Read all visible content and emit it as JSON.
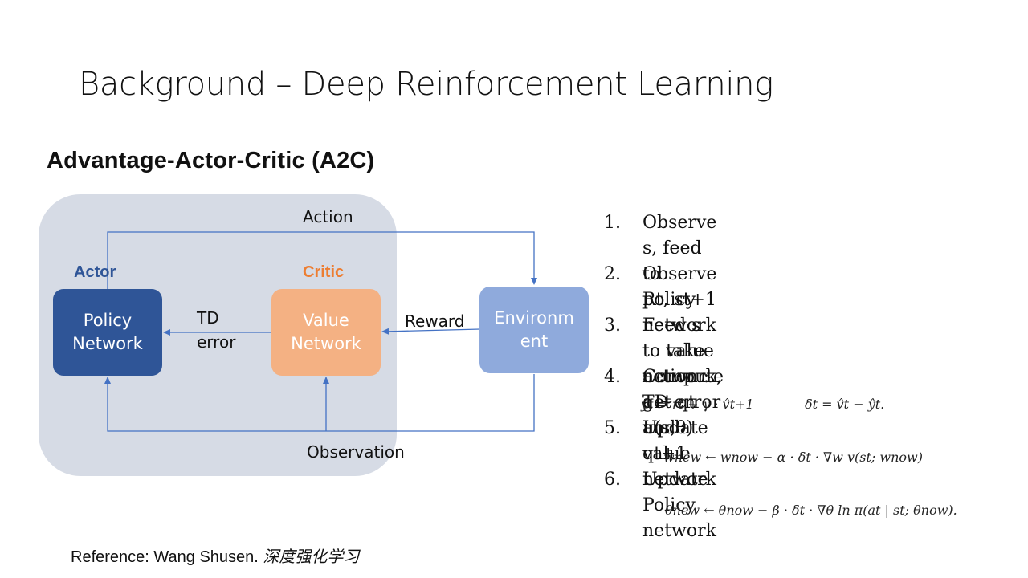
{
  "slide": {
    "title": "Background – Deep Reinforcement Learning",
    "subtitle": "Advantage-Actor-Critic (A2C)"
  },
  "diagram": {
    "colors": {
      "agent_region": "#d6dbe5",
      "actor": "#2f5597",
      "critic": "#f4b183",
      "environment": "#8faadc",
      "arrows": "#4472c4",
      "actor_role": "#2f5597",
      "critic_role": "#ed7d31"
    },
    "roles": {
      "actor": "Actor",
      "critic": "Critic"
    },
    "nodes": {
      "policy": "Policy\nNetwork",
      "value": "Value\nNetwork",
      "environment": "Environm\nent"
    },
    "edges": {
      "action": "Action",
      "td_error": "TD\nerror",
      "reward": "Reward",
      "observation": "Observation"
    }
  },
  "steps": [
    {
      "num": "1.",
      "text": "Observe s, feed to policy network to take\naction : a ~ π(s,θ)"
    },
    {
      "num": "2.",
      "text": "Observe Rt, st+1"
    },
    {
      "num": "3.",
      "text": "Feed s to value network, get qt and qt+1"
    },
    {
      "num": "4.",
      "text": "Compute TD error"
    },
    {
      "num": "5.",
      "text": "Update value network"
    },
    {
      "num": "6.",
      "text": "Update Policy network"
    }
  ],
  "formulas": {
    "td_target": "ŷt  =  rt + γ · v̂t+1",
    "td_delta": "δt  =  v̂t − ŷt.",
    "value_update": "wnew  ←  wnow − α · δt · ∇w v(st; wnow)",
    "policy_update": "θnew  ←  θnow − β · δt · ∇θ ln π(at | st; θnow)."
  },
  "reference": {
    "prefix": "Reference: Wang Shusen. ",
    "work": "深度强化学习"
  }
}
